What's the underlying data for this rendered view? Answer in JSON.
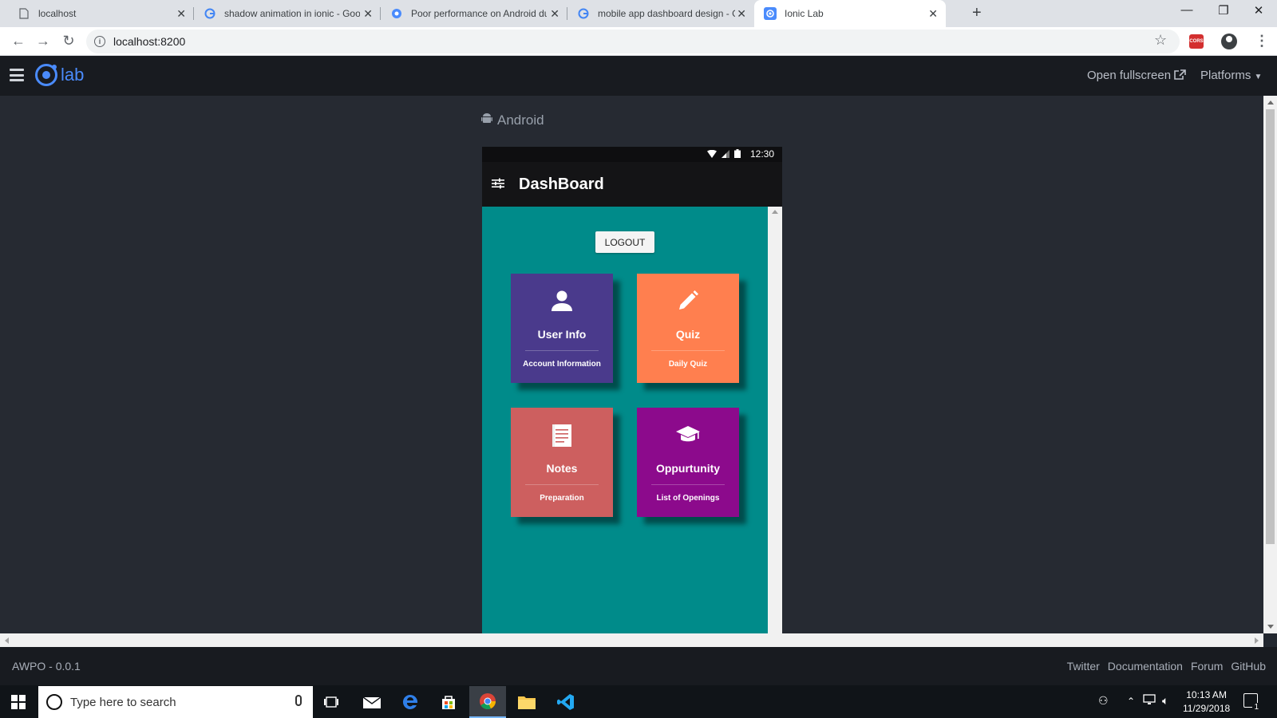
{
  "browser": {
    "tabs": [
      {
        "label": "localhost",
        "icon": "page-icon"
      },
      {
        "label": "shadow animation in ionic - Goo",
        "icon": "google-icon"
      },
      {
        "label": "Poor performance on Android du",
        "icon": "site-icon"
      },
      {
        "label": "mobile app dashboard design - G",
        "icon": "google-icon"
      },
      {
        "label": "Ionic Lab",
        "icon": "ionic-icon"
      }
    ],
    "url": "localhost:8200",
    "extension_label": "CORS"
  },
  "lab": {
    "logo_text": "lab",
    "open_fullscreen": "Open fullscreen",
    "platforms": "Platforms",
    "platform_name": "Android",
    "footer_version": "AWPO - 0.0.1",
    "footer_links": [
      "Twitter",
      "Documentation",
      "Forum",
      "GitHub"
    ]
  },
  "device": {
    "time": "12:30",
    "title": "DashBoard",
    "logout_label": "LOGOUT",
    "tiles": [
      {
        "title": "User Info",
        "subtitle": "Account Information",
        "color": "#4a3a8c",
        "icon": "user-icon"
      },
      {
        "title": "Quiz",
        "subtitle": "Daily Quiz",
        "color": "#ff7f4f",
        "icon": "pencil-icon"
      },
      {
        "title": "Notes",
        "subtitle": "Preparation",
        "color": "#cd5f5f",
        "icon": "notes-icon"
      },
      {
        "title": "Oppurtunity",
        "subtitle": "List of Openings",
        "color": "#8c0a8c",
        "icon": "graduation-cap-icon"
      }
    ]
  },
  "taskbar": {
    "search_placeholder": "Type here to search",
    "time": "10:13 AM",
    "date": "11/29/2018",
    "notification_count": "1"
  },
  "colors": {
    "device_bg": "#008b8a",
    "lab_accent": "#4a8bfc",
    "lab_bg": "#262a32"
  }
}
